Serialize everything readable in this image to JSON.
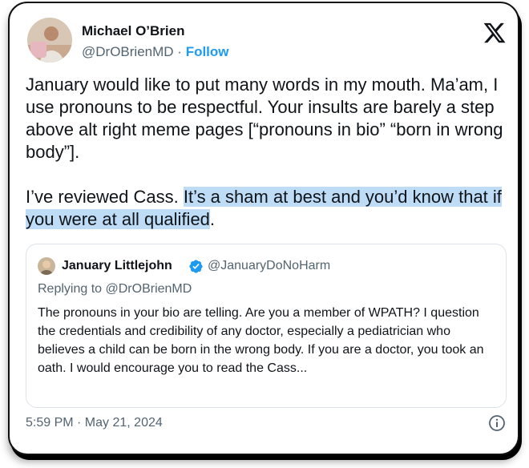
{
  "author": {
    "name": "Michael O’Brien",
    "handle": "@DrOBrienMD",
    "separator": "·",
    "follow_label": "Follow"
  },
  "tweet": {
    "paragraph1": "January would like to put many words in my mouth. Ma’am, I use pronouns to be respectful. Your insults are barely a step above alt right meme pages [“pronouns in bio” “born in wrong body”].",
    "paragraph2_plain": "I’ve reviewed Cass. ",
    "paragraph2_highlight": "It’s a sham at best and you’d know that if you were at all qualified",
    "paragraph2_end": "."
  },
  "quote": {
    "name": "January Littlejohn",
    "handle": "@JanuaryDoNoHarm",
    "replying_to": "Replying to @DrOBrienMD",
    "text": "The pronouns in your bio are telling. Are you a member of WPATH? I question the credentials and credibility of any doctor, especially a pediatrician who believes a child can be born in the wrong body. If you are a doctor, you took an oath. I would encourage you to read the Cass..."
  },
  "timestamp": "5:59 PM · May 21, 2024",
  "icons": {
    "platform": "x-logo-icon",
    "verified": "verified-badge-icon",
    "info": "info-icon"
  },
  "colors": {
    "accent": "#1d9bf0",
    "highlight": "#bfdcf7",
    "secondary_text": "#536471"
  }
}
